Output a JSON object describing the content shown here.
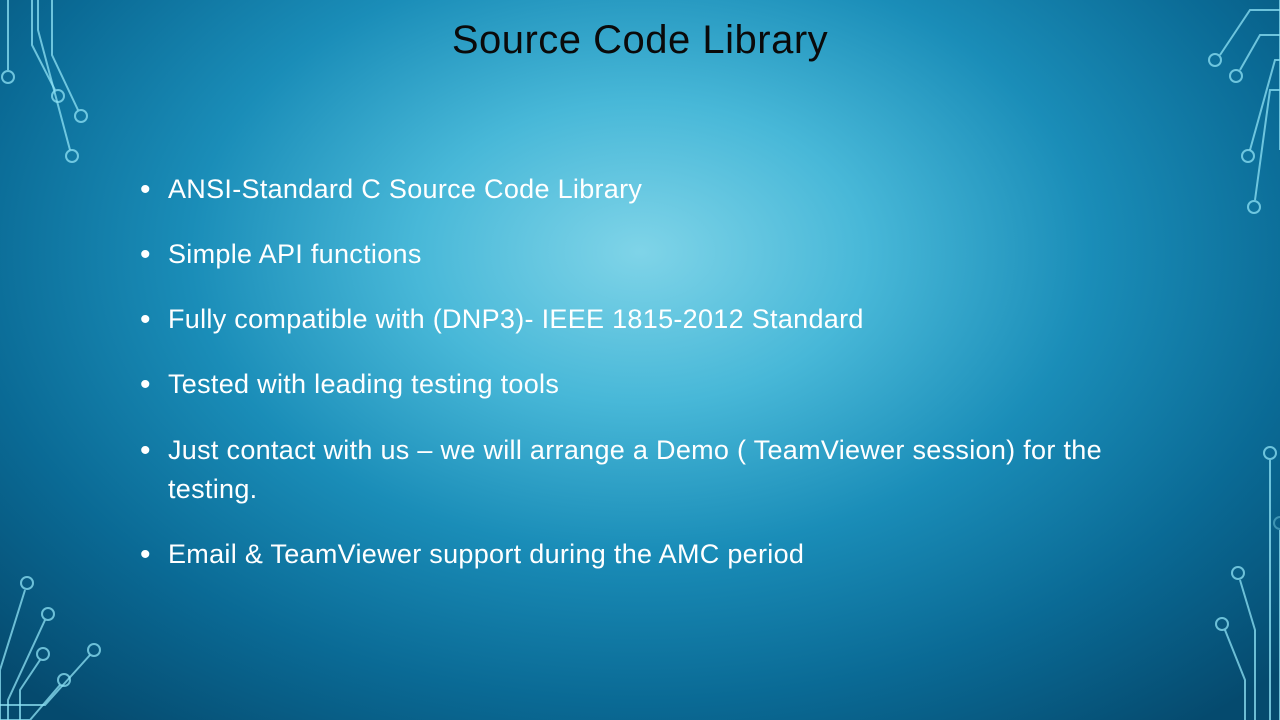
{
  "title": "Source Code Library",
  "bullets": [
    "ANSI-Standard C Source Code Library",
    "Simple API functions",
    "Fully compatible with (DNP3)- IEEE 1815-2012 Standard",
    "Tested with leading testing tools",
    "Just contact with us – we will arrange a Demo ( TeamViewer session) for the testing.",
    "Email & TeamViewer support during the AMC period"
  ]
}
